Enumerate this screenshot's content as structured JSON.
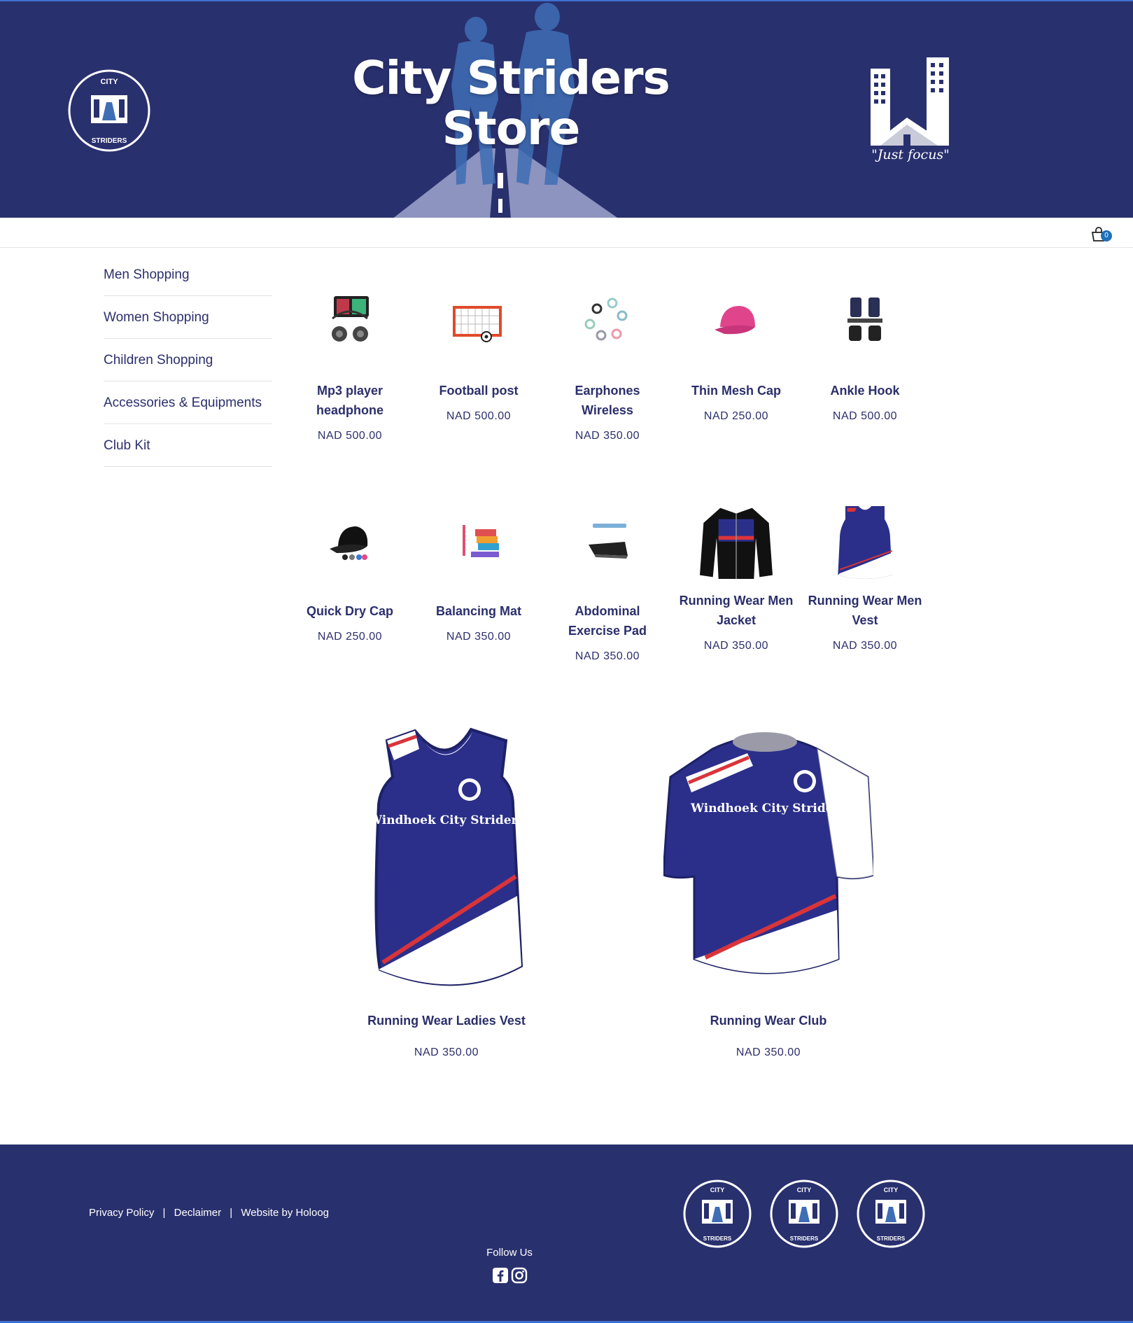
{
  "header": {
    "title_line1": "City Striders",
    "title_line2": "Store",
    "slogan": "\"Just focus\"",
    "badge_text_top": "CITY",
    "badge_text_bottom": "STRIDERS"
  },
  "cart": {
    "count": "0"
  },
  "sidebar": {
    "items": [
      {
        "label": "Men Shopping"
      },
      {
        "label": "Women Shopping"
      },
      {
        "label": "Children Shopping"
      },
      {
        "label": "Accessories & Equipments"
      },
      {
        "label": "Club Kit"
      }
    ]
  },
  "products": [
    {
      "name": "Mp3 player headphone",
      "price": "NAD 500.00",
      "icon": "mp3-headphone-image"
    },
    {
      "name": "Football post",
      "price": "NAD 500.00",
      "icon": "football-post-image"
    },
    {
      "name": "Earphones Wireless",
      "price": "NAD 350.00",
      "icon": "earphones-image"
    },
    {
      "name": "Thin Mesh Cap",
      "price": "NAD 250.00",
      "icon": "pink-cap-image"
    },
    {
      "name": "Ankle Hook",
      "price": "NAD 500.00",
      "icon": "ankle-hook-image"
    },
    {
      "name": "Quick Dry Cap",
      "price": "NAD 250.00",
      "icon": "black-cap-image"
    },
    {
      "name": "Balancing Mat",
      "price": "NAD 350.00",
      "icon": "balancing-mat-image"
    },
    {
      "name": "Abdominal Exercise Pad",
      "price": "NAD 350.00",
      "icon": "exercise-pad-image"
    },
    {
      "name": "Running Wear Men Jacket",
      "price": "NAD 350.00",
      "icon": "jacket-image"
    },
    {
      "name": "Running Wear Men Vest",
      "price": "NAD 350.00",
      "icon": "men-vest-image"
    }
  ],
  "featured": [
    {
      "name": "Running Wear Ladies Vest",
      "price": "NAD 350.00",
      "print": "Windhoek City Striders"
    },
    {
      "name": "Running Wear Club",
      "price": "NAD 350.00",
      "print": "Windhoek City Striders"
    }
  ],
  "footer": {
    "privacy": "Privacy Policy",
    "disclaimer": "Declaimer",
    "credit": "Website by Holoog",
    "separator": "|",
    "follow": "Follow Us"
  },
  "colors": {
    "brand_navy": "#29306e",
    "accent_blue": "#1f6fb8",
    "stripe_red": "#d9343a"
  }
}
